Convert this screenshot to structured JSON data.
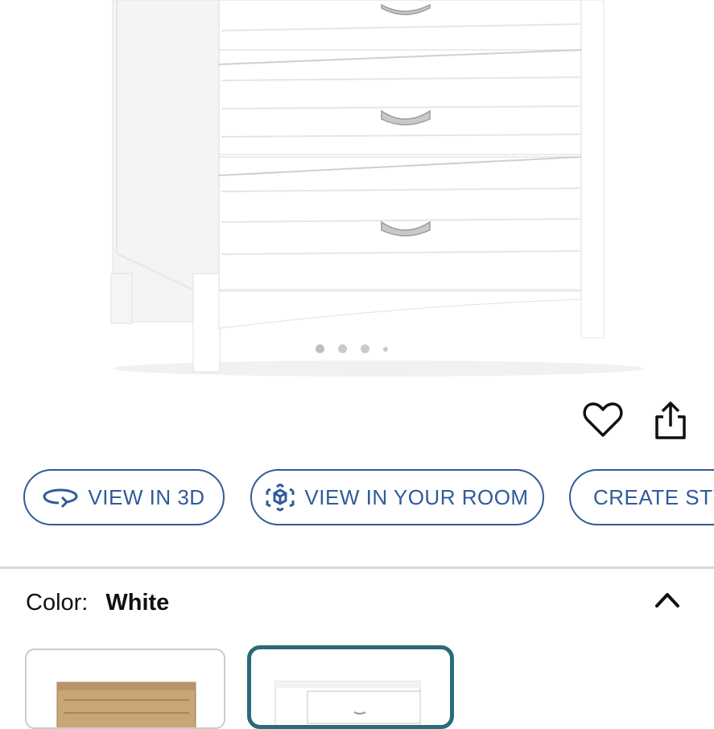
{
  "product": {
    "image_alt": "White 3-drawer dresser",
    "carousel_dot_count": 4,
    "carousel_active_index": 0
  },
  "actions": {
    "favorite_icon": "heart-icon",
    "share_icon": "share-icon"
  },
  "buttons": {
    "view_3d": "VIEW IN 3D",
    "view_room": "VIEW IN YOUR ROOM",
    "create_style": "CREATE STY"
  },
  "color": {
    "label": "Color:",
    "value": "White"
  },
  "swatches": [
    {
      "name": "Natural"
    },
    {
      "name": "White",
      "selected": true
    }
  ],
  "colors": {
    "accent": "#2f5b9a",
    "selected_border": "#2a6b78",
    "divider": "#d5d9d9"
  }
}
